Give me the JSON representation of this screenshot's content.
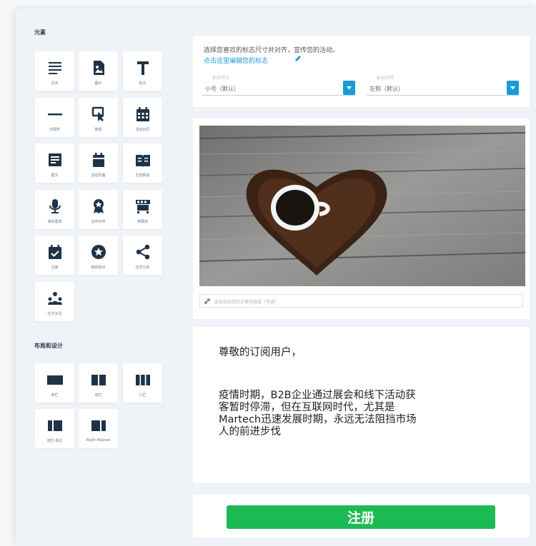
{
  "sidebar": {
    "elements_title": "元素",
    "layout_title": "布局和设计",
    "elements": [
      {
        "label": "文本",
        "icon": "text-lines-icon"
      },
      {
        "label": "图片",
        "icon": "image-icon"
      },
      {
        "label": "抬头",
        "icon": "title-t-icon"
      },
      {
        "label": "分隔符",
        "icon": "divider-icon"
      },
      {
        "label": "按钮",
        "icon": "click-button-icon"
      },
      {
        "label": "活动日历",
        "icon": "calendar-icon"
      },
      {
        "label": "图文",
        "icon": "image-text-icon"
      },
      {
        "label": "活动页面",
        "icon": "event-page-icon"
      },
      {
        "label": "互动频道",
        "icon": "book-icon"
      },
      {
        "label": "演讲嘉宾",
        "icon": "microphone-icon"
      },
      {
        "label": "合作伙伴",
        "icon": "badge-icon"
      },
      {
        "label": "参展商",
        "icon": "booth-icon"
      },
      {
        "label": "注册",
        "icon": "register-check-icon"
      },
      {
        "label": "组织标识",
        "icon": "star-circle-icon"
      },
      {
        "label": "社交分享",
        "icon": "share-icon"
      },
      {
        "label": "社交关注",
        "icon": "social-follow-icon"
      }
    ],
    "layouts": [
      {
        "label": "单栏",
        "icon": "single-column-icon"
      },
      {
        "label": "双栏",
        "icon": "two-column-icon"
      },
      {
        "label": "三栏",
        "icon": "three-column-icon"
      },
      {
        "label": "双栏-靠左",
        "icon": "left-aligned-icon"
      },
      {
        "label": "Right Aligned",
        "icon": "right-aligned-icon"
      }
    ]
  },
  "logo_panel": {
    "hint": "选择您喜欢的标志尺寸并对齐，宣传您的活动。",
    "edit_link": "点击这里编辑您的标志",
    "size_select": {
      "legend": "标识尺寸",
      "value": "小号（默认）"
    },
    "align_select": {
      "legend": "标识对齐",
      "value": "左侧（默认）"
    }
  },
  "image_panel": {
    "link_placeholder": "此处粘贴您的文章的链接（可选）"
  },
  "text_panel": {
    "greeting": "尊敬的订阅用户，",
    "paragraph_lines": [
      "疫情时期，B2B企业通过展会和线下活动获",
      "客暂时停滞，但在互联网时代，尤其是",
      "Martech迅速发展时期，永远无法阻挡市场",
      "人的前进步伐"
    ]
  },
  "register_button": {
    "label": "注册"
  },
  "colors": {
    "accent_blue": "#1a9bd7",
    "register_green": "#1db954",
    "icon_dark": "#1f3347"
  }
}
